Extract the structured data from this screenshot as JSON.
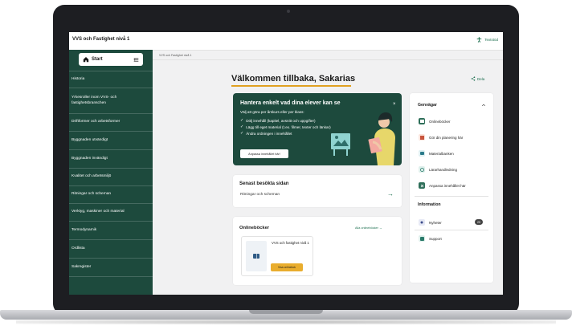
{
  "app": {
    "title": "VVS och Fastighet nivå 1",
    "textstod": "Textstöd"
  },
  "sidebar": {
    "start_label": "Start",
    "items": [
      {
        "label": "Historia"
      },
      {
        "label": "Yrkesroller inom VVS- och fastighetsbranschen"
      },
      {
        "label": "Driftformer och arbetsformer"
      },
      {
        "label": "Byggnaden utvändigt"
      },
      {
        "label": "Byggnaden invändigt"
      },
      {
        "label": "Kvalitet och arbetsmiljö"
      },
      {
        "label": "Ritningar och scheman"
      },
      {
        "label": "Verktyg, maskiner och material"
      },
      {
        "label": "Termodynamik"
      },
      {
        "label": "Ordlista"
      },
      {
        "label": "Sakregister"
      }
    ]
  },
  "breadcrumb": "VVS och Fastighet nivå 1",
  "main": {
    "welcome": "Välkommen tillbaka, Sakarias",
    "share_label": "Dela",
    "promo": {
      "title": "Hantera enkelt vad dina elever kan se",
      "subtitle": "Välj att göra per årskurs eller per klass:",
      "items": [
        "Dölj innehåll (kapitel, avsnitt och uppgifter)",
        "Lägg till eget material (t.ex. filmer, texter och länkar)",
        "Ändra ordningen i innehållet"
      ],
      "button": "Anpassa innehållet här!"
    },
    "recent": {
      "title": "Senast besökta sidan",
      "link": "Ritningar och scheman"
    },
    "books": {
      "title": "Onlineböcker",
      "all_link": "Alla onlineböcker",
      "book_name": "VVS och fastighet nivå 1",
      "book_button": "Visa onlinebok"
    }
  },
  "right_panel": {
    "shortcuts_title": "Genvägar",
    "shortcuts": [
      {
        "label": "Onlineböcker",
        "icon": "book-icon",
        "color": "#2f6f5a"
      },
      {
        "label": "Gör din planering här",
        "icon": "planner-icon",
        "color": "#c8553d"
      },
      {
        "label": "Materialbanken",
        "icon": "material-icon",
        "color": "#2a7a8a"
      },
      {
        "label": "Lärarhandledning",
        "icon": "guide-icon",
        "color": "#2a7a6a"
      },
      {
        "label": "Anpassa innehållet här",
        "icon": "customize-icon",
        "color": "#2f6f5a"
      }
    ],
    "info_title": "Information",
    "info": [
      {
        "label": "Nyheter",
        "icon": "news-icon",
        "badge": "29"
      },
      {
        "label": "Support",
        "icon": "support-icon"
      }
    ]
  }
}
